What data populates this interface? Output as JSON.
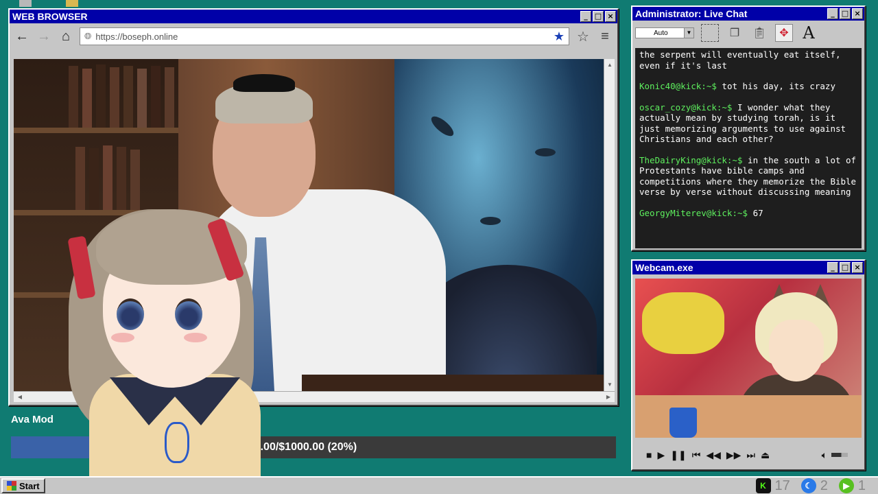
{
  "browser": {
    "title": "WEB BROWSER",
    "url": "https://boseph.online",
    "icons": [
      "back-arrow-icon",
      "forward-arrow-icon",
      "home-icon",
      "globe-icon",
      "bookmark-star-filled-icon",
      "star-outline-icon",
      "hamburger-menu-icon"
    ]
  },
  "chat": {
    "title": "Administrator: Live Chat",
    "font_select": "Auto",
    "messages": [
      {
        "user": "",
        "text": "the serpent will eventually eat itself, even if it's last"
      },
      {
        "user": "Konic40@kick:~$",
        "text": "tot his day, its crazy"
      },
      {
        "user": "oscar_cozy@kick:~$",
        "text": "I wonder what they actually mean by studying torah, is it just memorizing arguments to use against Christians and each other?"
      },
      {
        "user": "TheDairyKing@kick:~$",
        "text": "in the south a lot of Protestants have bible camps and competitions where they memorize the Bible verse by verse without discussing meaning"
      },
      {
        "user": "GeorgyMiterev@kick:~$",
        "text": "67"
      }
    ]
  },
  "webcam": {
    "title": "Webcam.exe"
  },
  "donation": {
    "label": "Ava Mod",
    "progress_text": "$203.00/$1000.00 (20%)",
    "progress_fraction": 0.203
  },
  "taskbar": {
    "start_label": "Start",
    "kick_count": "17",
    "moon_count": "2",
    "play_count": "1"
  },
  "colors": {
    "desktop": "#107b72",
    "titlebar": "#0000a8",
    "chat_user": "#5ef05e",
    "donation_fill": "#3a62a8"
  }
}
